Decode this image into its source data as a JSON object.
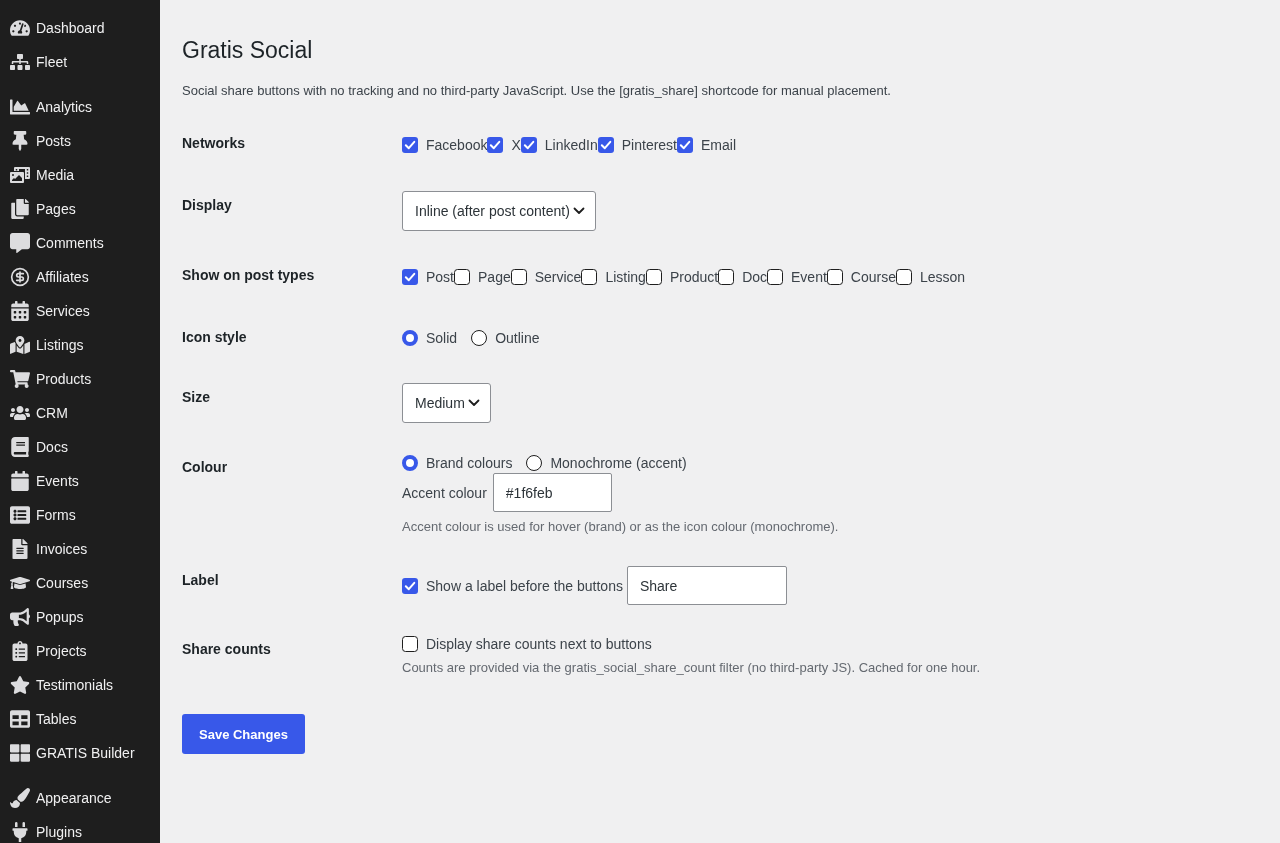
{
  "sidebar": {
    "sections": [
      {
        "items": [
          {
            "label": "Dashboard"
          },
          {
            "label": "Fleet"
          }
        ]
      },
      {
        "items": [
          {
            "label": "Analytics"
          },
          {
            "label": "Posts"
          },
          {
            "label": "Media"
          },
          {
            "label": "Pages"
          },
          {
            "label": "Comments"
          },
          {
            "label": "Affiliates"
          },
          {
            "label": "Services"
          },
          {
            "label": "Listings"
          },
          {
            "label": "Products"
          },
          {
            "label": "CRM"
          },
          {
            "label": "Docs"
          },
          {
            "label": "Events"
          },
          {
            "label": "Forms"
          },
          {
            "label": "Invoices"
          },
          {
            "label": "Courses"
          },
          {
            "label": "Popups"
          },
          {
            "label": "Projects"
          },
          {
            "label": "Testimonials"
          },
          {
            "label": "Tables"
          },
          {
            "label": "GRATIS Builder"
          }
        ]
      },
      {
        "items": [
          {
            "label": "Appearance"
          },
          {
            "label": "Plugins"
          }
        ]
      }
    ]
  },
  "page": {
    "title": "Gratis Social",
    "description": "Social share buttons with no tracking and no third-party JavaScript. Use the [gratis_share] shortcode for manual placement."
  },
  "settings": [
    {
      "kind": "checkboxes",
      "label": "Networks",
      "options": [
        {
          "label": "Facebook",
          "checked": true
        },
        {
          "label": "X",
          "checked": true
        },
        {
          "label": "LinkedIn",
          "checked": true
        },
        {
          "label": "Pinterest",
          "checked": true
        },
        {
          "label": "Email",
          "checked": true
        }
      ]
    },
    {
      "kind": "select",
      "label": "Display",
      "value": "Inline (after post content)"
    },
    {
      "kind": "checkboxes",
      "label": "Show on post types",
      "options": [
        {
          "label": "Post",
          "checked": true
        },
        {
          "label": "Page",
          "checked": false
        },
        {
          "label": "Service",
          "checked": false
        },
        {
          "label": "Listing",
          "checked": false
        },
        {
          "label": "Product",
          "checked": false
        },
        {
          "label": "Doc",
          "checked": false
        },
        {
          "label": "Event",
          "checked": false
        },
        {
          "label": "Course",
          "checked": false
        },
        {
          "label": "Lesson",
          "checked": false
        }
      ]
    },
    {
      "kind": "radios",
      "label": "Icon style",
      "options": [
        {
          "label": "Solid",
          "selected": true
        },
        {
          "label": "Outline",
          "selected": false
        }
      ]
    },
    {
      "kind": "select",
      "label": "Size",
      "value": "Medium"
    },
    {
      "kind": "colour",
      "label": "Colour",
      "options": [
        {
          "label": "Brand colours",
          "selected": true
        },
        {
          "label": "Monochrome (accent)",
          "selected": false
        }
      ],
      "field": {
        "label": "Accent colour",
        "value": "#1f6feb"
      },
      "description": "Accent colour is used for hover (brand) or as the icon colour (monochrome)."
    },
    {
      "kind": "checkbox_with_field",
      "label": "Label",
      "checkbox": {
        "label": "Show a label before the buttons",
        "checked": true
      },
      "field": {
        "value": "Share"
      }
    },
    {
      "kind": "checkbox",
      "label": "Share counts",
      "checkbox": {
        "label": "Display share counts next to buttons",
        "checked": false
      },
      "description": "Counts are provided via the gratis_social_share_count filter (no third-party JS). Cached for one hour."
    }
  ],
  "save_button": {
    "label": "Save Changes"
  }
}
